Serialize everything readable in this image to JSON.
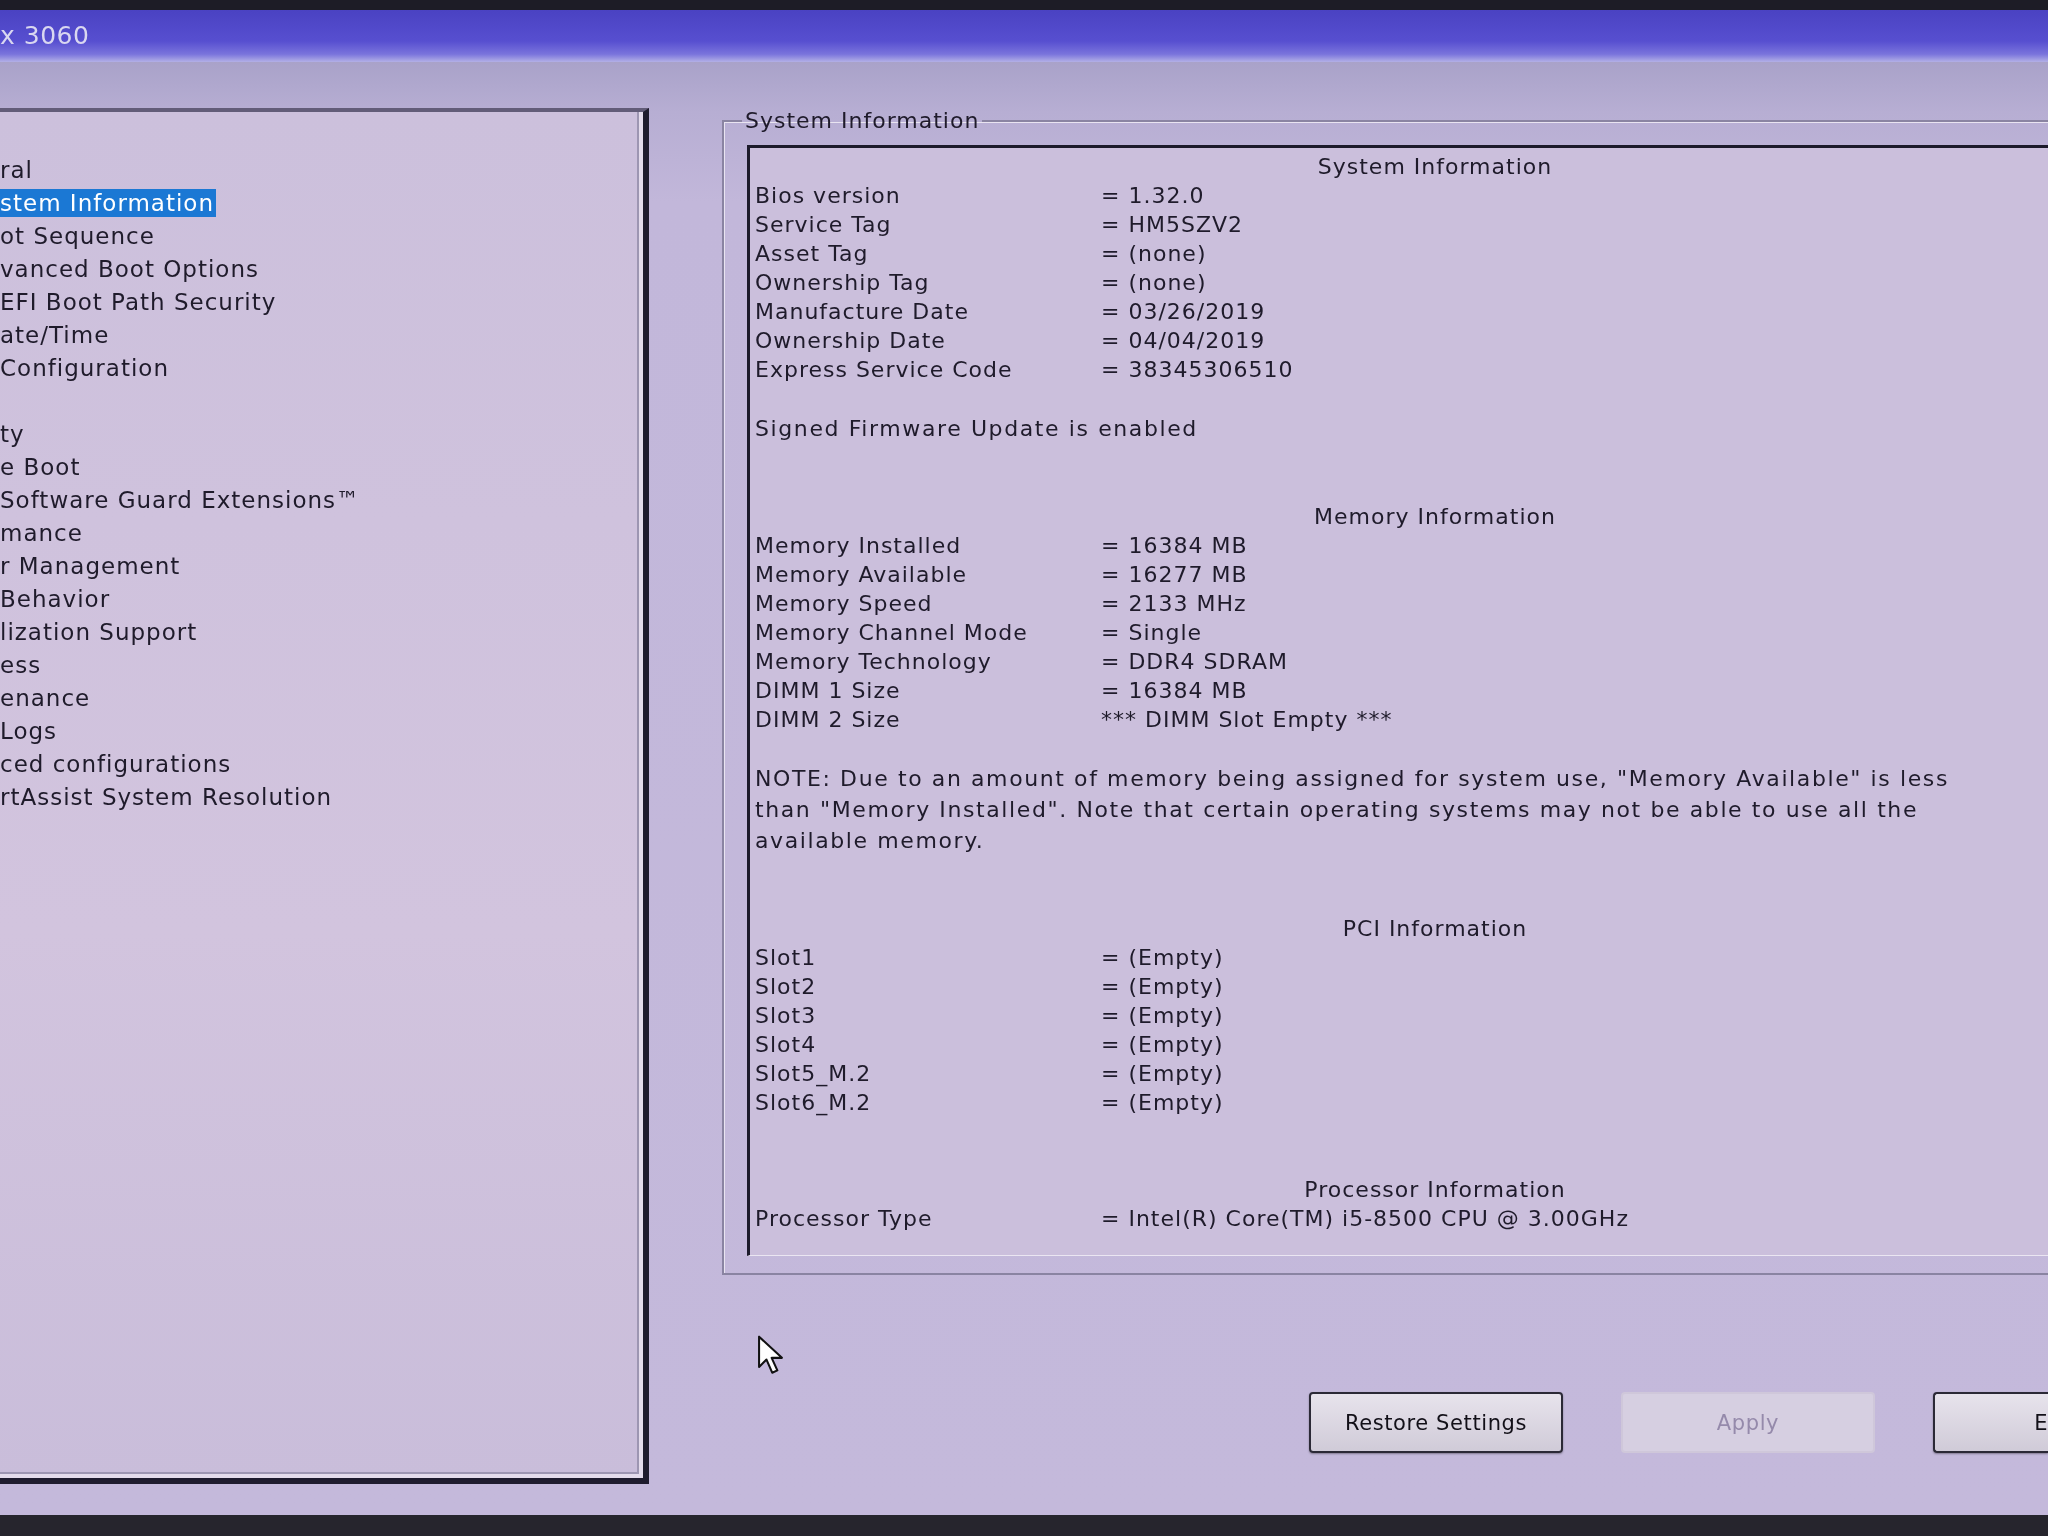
{
  "window": {
    "title": "x 3060"
  },
  "sidebar": {
    "groups": [
      {
        "items": [
          {
            "label": "ral",
            "selected": false
          },
          {
            "label": "stem Information",
            "selected": true
          },
          {
            "label": "ot Sequence",
            "selected": false
          },
          {
            "label": "vanced Boot Options",
            "selected": false
          },
          {
            "label": "EFI Boot Path Security",
            "selected": false
          },
          {
            "label": "ate/Time",
            "selected": false
          },
          {
            "label": "Configuration",
            "selected": false
          }
        ]
      },
      {
        "items": [
          {
            "label": "ty",
            "selected": false
          },
          {
            "label": "e Boot",
            "selected": false
          },
          {
            "label": "Software Guard Extensions™",
            "selected": false
          },
          {
            "label": "mance",
            "selected": false
          },
          {
            "label": "r Management",
            "selected": false
          },
          {
            "label": "Behavior",
            "selected": false
          },
          {
            "label": "lization Support",
            "selected": false
          },
          {
            "label": "ess",
            "selected": false
          },
          {
            "label": "enance",
            "selected": false
          },
          {
            "label": "Logs",
            "selected": false
          },
          {
            "label": "ced configurations",
            "selected": false
          },
          {
            "label": "rtAssist System Resolution",
            "selected": false
          }
        ]
      }
    ]
  },
  "group_box": {
    "title": "System Information",
    "sections": [
      {
        "heading": "System Information",
        "rows": [
          {
            "label": "Bios version",
            "value": "= 1.32.0"
          },
          {
            "label": "Service Tag",
            "value": "= HM5SZV2"
          },
          {
            "label": "Asset Tag",
            "value": "= (none)"
          },
          {
            "label": "Ownership Tag",
            "value": "= (none)"
          },
          {
            "label": "Manufacture Date",
            "value": "= 03/26/2019"
          },
          {
            "label": "Ownership Date",
            "value": "= 04/04/2019"
          },
          {
            "label": "Express Service Code",
            "value": "= 38345306510"
          }
        ],
        "note": "Signed Firmware Update is enabled"
      },
      {
        "heading": "Memory Information",
        "rows": [
          {
            "label": "Memory Installed",
            "value": "= 16384 MB"
          },
          {
            "label": "Memory Available",
            "value": "= 16277 MB"
          },
          {
            "label": "Memory Speed",
            "value": "= 2133 MHz"
          },
          {
            "label": "Memory Channel Mode",
            "value": "= Single"
          },
          {
            "label": "Memory Technology",
            "value": "= DDR4 SDRAM"
          },
          {
            "label": "DIMM 1 Size",
            "value": "= 16384 MB"
          },
          {
            "label": "DIMM 2 Size",
            "value": "*** DIMM Slot Empty ***"
          }
        ],
        "note": "NOTE: Due to an amount of memory being assigned for system use, \"Memory Available\" is less than \"Memory Installed\". Note that certain operating systems may not be able to use all the available memory."
      },
      {
        "heading": "PCI Information",
        "rows": [
          {
            "label": "Slot1",
            "value": "= (Empty)"
          },
          {
            "label": "Slot2",
            "value": "= (Empty)"
          },
          {
            "label": "Slot3",
            "value": "= (Empty)"
          },
          {
            "label": "Slot4",
            "value": "= (Empty)"
          },
          {
            "label": "Slot5_M.2",
            "value": "= (Empty)"
          },
          {
            "label": "Slot6_M.2",
            "value": "= (Empty)"
          }
        ]
      },
      {
        "heading": "Processor Information",
        "rows": [
          {
            "label": "Processor Type",
            "value": "= Intel(R) Core(TM) i5-8500 CPU @ 3.00GHz"
          }
        ]
      }
    ]
  },
  "buttons": [
    {
      "label": "Restore Settings",
      "disabled": false
    },
    {
      "label": "Apply",
      "disabled": true
    },
    {
      "label": "E",
      "disabled": false
    }
  ]
}
